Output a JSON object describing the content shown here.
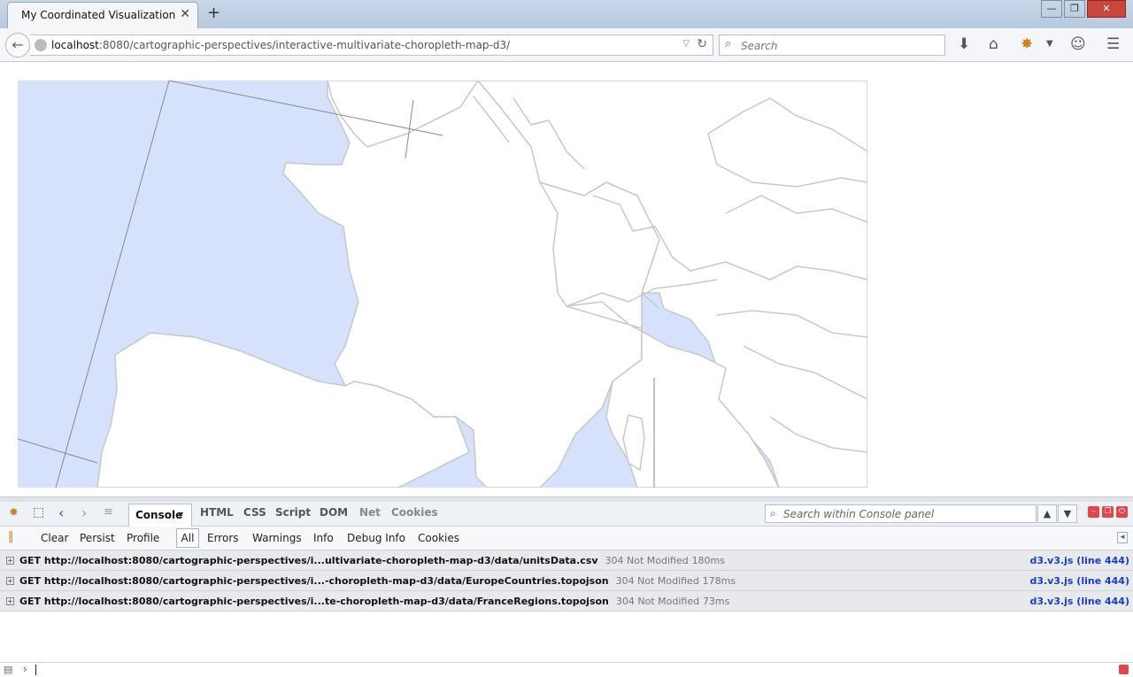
{
  "browser": {
    "tab_title": "My Coordinated Visualization",
    "tab_close": "✕",
    "new_tab": "+",
    "window_controls": {
      "minimize": "—",
      "restore": "❐",
      "close": "✕"
    }
  },
  "navbar": {
    "url_host": "localhost",
    "url_rest": ":8080/cartographic-perspectives/interactive-multivariate-choropleth-map-d3/",
    "search_placeholder": "Search"
  },
  "map": {
    "sea_color": "#d6e2fb",
    "land_color": "#ffffff",
    "border_color": "#c8c8c8"
  },
  "firebug": {
    "tabs": [
      "HTML",
      "CSS",
      "Script",
      "DOM",
      "Net",
      "Cookies"
    ],
    "active_tab": "Console",
    "search_placeholder": "Search within Console panel",
    "filter_buttons": [
      "Clear",
      "Persist",
      "Profile"
    ],
    "filter_levels": [
      "All",
      "Errors",
      "Warnings",
      "Info",
      "Debug Info",
      "Cookies"
    ],
    "logs": [
      {
        "method": "GET",
        "url": "http://localhost:8080/cartographic-perspectives/i...ultivariate-choropleth-map-d3/data/unitsData.csv",
        "status": "304 Not Modified",
        "time": "180ms",
        "source": "d3.v3.js (line 444)"
      },
      {
        "method": "GET",
        "url": "http://localhost:8080/cartographic-perspectives/i...-choropleth-map-d3/data/EuropeCountries.topojson",
        "status": "304 Not Modified",
        "time": "178ms",
        "source": "d3.v3.js (line 444)"
      },
      {
        "method": "GET",
        "url": "http://localhost:8080/cartographic-perspectives/i...te-choropleth-map-d3/data/FranceRegions.topojson",
        "status": "304 Not Modified",
        "time": "73ms",
        "source": "d3.v3.js (line 444)"
      }
    ]
  }
}
